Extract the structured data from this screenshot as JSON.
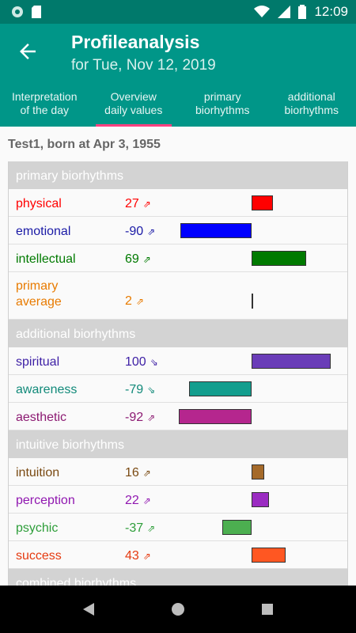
{
  "status_bar": {
    "time": "12:09"
  },
  "app_bar": {
    "title": "Profileanalysis",
    "subtitle": "for Tue, Nov 12, 2019",
    "tabs": [
      {
        "label_1": "Interpretation",
        "label_2": "of the day"
      },
      {
        "label_1": "Overview",
        "label_2": "daily values",
        "active": true
      },
      {
        "label_1": "primary",
        "label_2": "biorhythms"
      },
      {
        "label_1": "additional",
        "label_2": "biorhythms"
      }
    ]
  },
  "owner_line": "Test1, born at Apr 3, 1955",
  "sections": {
    "primary": {
      "title": "primary biorhythms"
    },
    "additional": {
      "title": "additional biorhythms"
    },
    "intuitive": {
      "title": "intuitive biorhythms"
    },
    "combined": {
      "title": "combined biorhythms"
    }
  },
  "rows": {
    "physical": {
      "name": "physical",
      "value": "27",
      "arrow": "⇗",
      "percent": 27,
      "color": "#ff0000"
    },
    "emotional": {
      "name": "emotional",
      "value": "-90",
      "arrow": "⇗",
      "percent": -90,
      "color": "#0000ff",
      "text_color": "#1a1aa6"
    },
    "intellectual": {
      "name": "intellectual",
      "value": "69",
      "arrow": "⇗",
      "percent": 69,
      "color": "#007a00"
    },
    "primary_average": {
      "name_1": "primary",
      "name_2": "average",
      "value": "2",
      "arrow": "⇗",
      "percent": 2,
      "color": "#e87b00"
    },
    "spiritual": {
      "name": "spiritual",
      "value": "100",
      "arrow": "⇘",
      "percent": 100,
      "color": "#6a3db8",
      "text_color": "#3d1fa5"
    },
    "awareness": {
      "name": "awareness",
      "value": "-79",
      "arrow": "⇘",
      "percent": -79,
      "color": "#139e8e",
      "text_color": "#128a7a"
    },
    "aesthetic": {
      "name": "aesthetic",
      "value": "-92",
      "arrow": "⇗",
      "percent": -92,
      "color": "#b5268e",
      "text_color": "#8c1a72"
    },
    "intuition": {
      "name": "intuition",
      "value": "16",
      "arrow": "⇗",
      "percent": 16,
      "color": "#a56a2a",
      "text_color": "#7a4a12"
    },
    "perception": {
      "name": "perception",
      "value": "22",
      "arrow": "⇗",
      "percent": 22,
      "color": "#9b2cc2",
      "text_color": "#9017b0"
    },
    "psychic": {
      "name": "psychic",
      "value": "-37",
      "arrow": "⇗",
      "percent": -37,
      "color": "#4caf50",
      "text_color": "#2e9e3a"
    },
    "success": {
      "name": "success",
      "value": "43",
      "arrow": "⇗",
      "percent": 43,
      "color": "#ff5722",
      "text_color": "#e53a10"
    }
  }
}
